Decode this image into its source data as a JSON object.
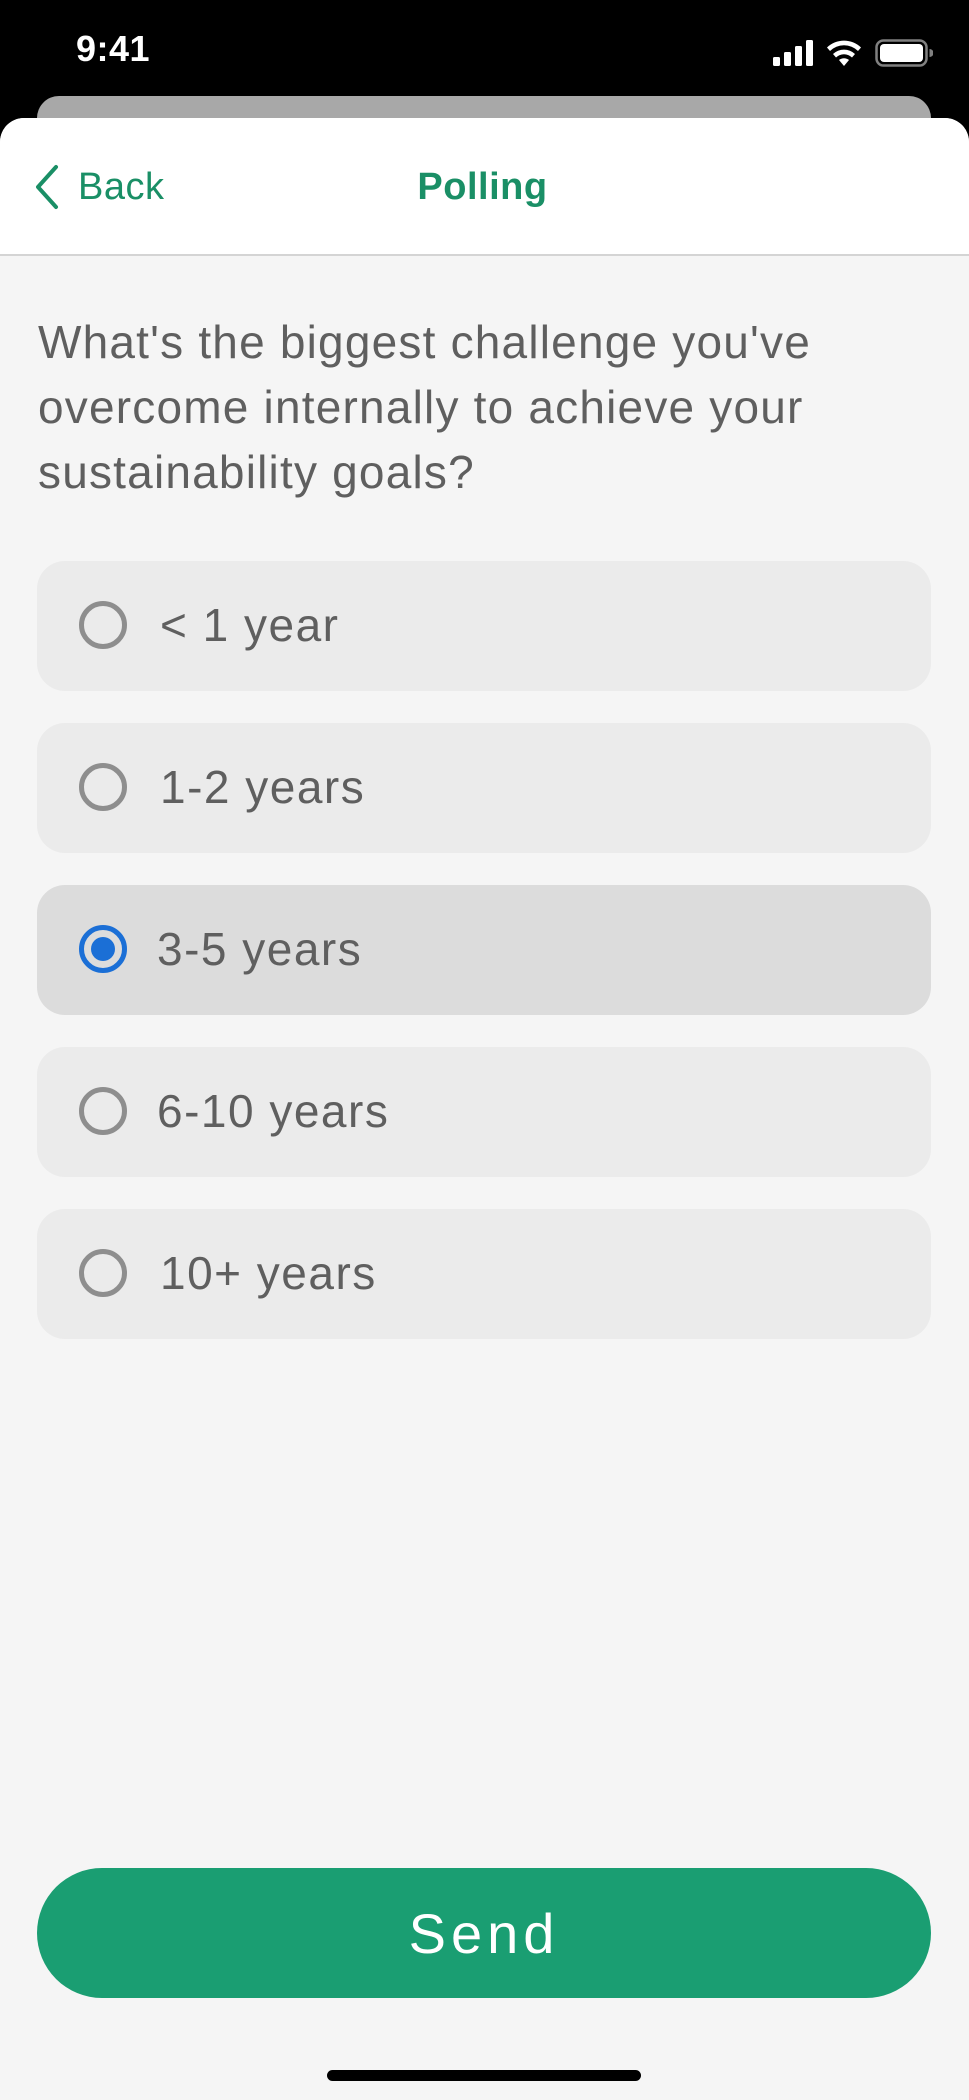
{
  "status_bar": {
    "time": "9:41"
  },
  "nav": {
    "back_label": "Back",
    "title": "Polling"
  },
  "poll": {
    "question": "What's the biggest challenge you've overcome internally to achieve your sustainability goals?",
    "options": [
      {
        "label": "< 1 year",
        "selected": false
      },
      {
        "label": "1-2 years",
        "selected": false
      },
      {
        "label": "3-5 years",
        "selected": true
      },
      {
        "label": "6-10 years",
        "selected": false
      },
      {
        "label": "10+ years",
        "selected": false
      }
    ]
  },
  "actions": {
    "send_label": "Send"
  },
  "colors": {
    "accent_green": "#1a8f66",
    "send_button": "#1a9e72",
    "radio_selected": "#1b6fd6",
    "option_bg": "#ebebeb",
    "option_selected_bg": "#dcdcdc",
    "page_bg": "#f5f5f5"
  },
  "icons": {
    "back": "chevron-left-icon",
    "signal": "cellular-signal-icon",
    "wifi": "wifi-icon",
    "battery": "battery-icon"
  }
}
